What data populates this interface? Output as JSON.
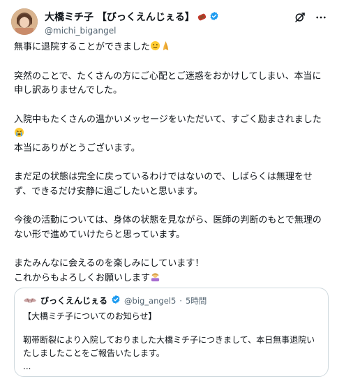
{
  "author": {
    "display_name": "大橋ミチ子 【びっくえんじぇる】",
    "handle": "@michi_bigangel"
  },
  "tweet": {
    "line1": "無事に退院することができました",
    "line2": "突然のことで、たくさんの方にご心配とご迷惑をおかけしてしまい、本当に申し訳ありませんでした。",
    "line3a": "入院中もたくさんの温かいメッセージをいただいて、すごく励まされました",
    "line3b": "本当にありがとうございます。",
    "line4": "まだ足の状態は完全に戻っているわけではないので、しばらくは無理をせず、できるだけ安静に過ごしたいと思います。",
    "line5": "今後の活動については、身体の状態を見ながら、医師の判断のもとで無理のない形で進めていけたらと思っています。",
    "line6a": "またみんなに会えるのを楽しみにしています！",
    "line6b": "これからもよろしくお願いします"
  },
  "quote": {
    "name": "びっくえんじぇる",
    "handle": "@big_angel5",
    "separator": "·",
    "time": "5時間",
    "title": "【大橋ミチ子についてのお知らせ】",
    "body": "靭帯断裂により入院しておりました大橋ミチ子につきまして、本日無事退院いたしましたことをご報告いたします。",
    "ellipsis": "..."
  },
  "icons": [
    "profile-avatar",
    "verified-badge",
    "grok-icon",
    "more-options-icon",
    "smile-emoji",
    "pray-emoji",
    "crying-emoji",
    "bow-emoji"
  ],
  "colors": {
    "verified_blue": "#1d9bf0",
    "text": "#0f1419",
    "muted": "#536471",
    "border": "#cfd9de"
  }
}
